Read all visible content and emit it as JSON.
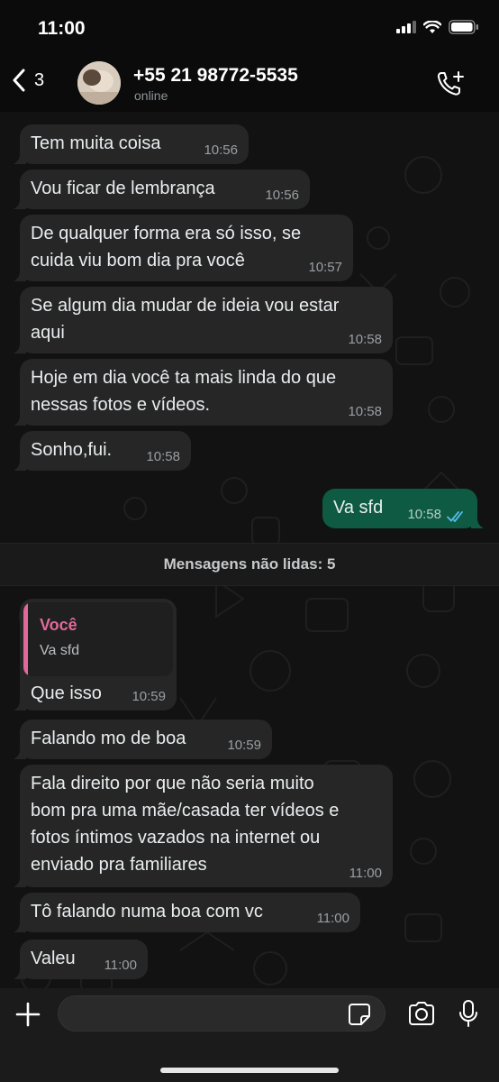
{
  "status_bar": {
    "time": "11:00"
  },
  "header": {
    "back_count": "3",
    "contact_name": "+55 21 98772-5535",
    "contact_status": "online"
  },
  "messages": [
    {
      "text": "Tem muita coisa",
      "time": "10:56"
    },
    {
      "text": "Vou ficar de lembrança",
      "time": "10:56"
    },
    {
      "text_lines": [
        "De qualquer forma era só isso, se",
        "cuida viu bom dia pra você"
      ],
      "time": "10:57"
    },
    {
      "text_lines": [
        "Se algum dia mudar de ideia vou estar",
        "aqui"
      ],
      "time": "10:58"
    },
    {
      "text_lines": [
        "Hoje em dia você ta mais linda do que",
        "nessas fotos e vídeos."
      ],
      "time": "10:58"
    },
    {
      "text": "Sonho,fui.",
      "time": "10:58"
    },
    {
      "text": "Va sfd",
      "time": "10:58",
      "outgoing": true,
      "status": "read"
    }
  ],
  "unread_divider": "Mensagens não lidas: 5",
  "unread_messages": [
    {
      "quote_author": "Você",
      "quote_text": "Va sfd",
      "text": "Que isso",
      "time": "10:59"
    },
    {
      "text": "Falando mo de boa",
      "time": "10:59"
    },
    {
      "text_lines": [
        "Fala direito por que não seria muito",
        "bom pra uma mãe/casada ter vídeos e",
        "fotos íntimos vazados na internet ou",
        "enviado pra familiares"
      ],
      "time": "11:00"
    },
    {
      "text": "Tô falando numa boa com vc",
      "time": "11:00"
    },
    {
      "text": "Valeu",
      "time": "11:00"
    }
  ],
  "colors": {
    "incoming": "#262626",
    "outgoing": "#0f5a42",
    "read_ticks": "#53bdeb",
    "quote_accent": "#e0699a"
  },
  "icons": [
    "back-chevron-icon",
    "call-plus-icon",
    "plus-icon",
    "sticker-icon",
    "camera-icon",
    "microphone-icon",
    "signal-icon",
    "wifi-icon",
    "battery-icon"
  ]
}
